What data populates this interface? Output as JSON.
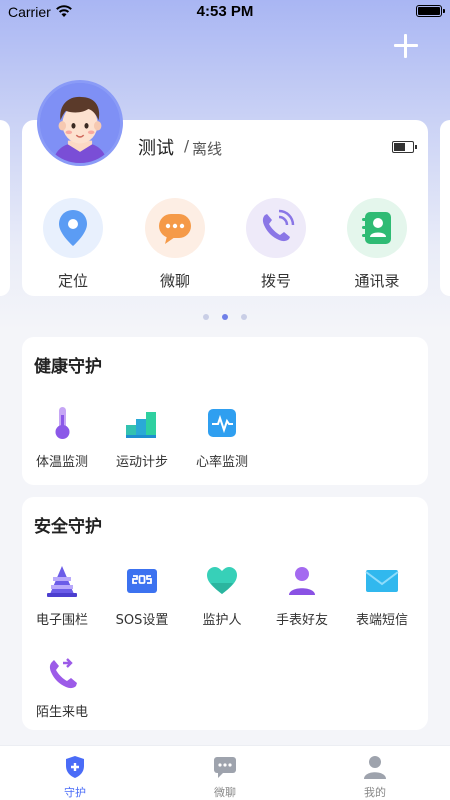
{
  "status_bar": {
    "carrier": "Carrier",
    "time": "4:53 PM"
  },
  "device": {
    "name": "测试",
    "separator": "/",
    "status": "离线",
    "actions": [
      {
        "label": "定位",
        "icon": "location-icon"
      },
      {
        "label": "微聊",
        "icon": "chat-bubble-icon"
      },
      {
        "label": "拨号",
        "icon": "phone-icon"
      },
      {
        "label": "通讯录",
        "icon": "contacts-icon"
      }
    ]
  },
  "carousel": {
    "pages": 3,
    "active_index": 1
  },
  "health": {
    "title": "健康守护",
    "items": [
      {
        "label": "体温监测",
        "icon": "thermometer-icon"
      },
      {
        "label": "运动计步",
        "icon": "steps-icon"
      },
      {
        "label": "心率监测",
        "icon": "heart-rate-icon"
      }
    ]
  },
  "safety": {
    "title": "安全守护",
    "items": [
      {
        "label": "电子围栏",
        "icon": "geofence-cone-icon"
      },
      {
        "label": "SOS设置",
        "icon": "sos-icon"
      },
      {
        "label": "监护人",
        "icon": "heart-icon"
      },
      {
        "label": "手表好友",
        "icon": "friend-icon"
      },
      {
        "label": "表端短信",
        "icon": "envelope-icon"
      },
      {
        "label": "陌生来电",
        "icon": "incoming-call-icon"
      }
    ]
  },
  "tabbar": {
    "items": [
      {
        "label": "守护",
        "icon": "shield-icon",
        "active": true
      },
      {
        "label": "微聊",
        "icon": "chat-icon",
        "active": false
      },
      {
        "label": "我的",
        "icon": "user-icon",
        "active": false
      }
    ]
  },
  "colors": {
    "accent": "#4a6cf7",
    "header_gradient_top": "#a9b6f3"
  }
}
